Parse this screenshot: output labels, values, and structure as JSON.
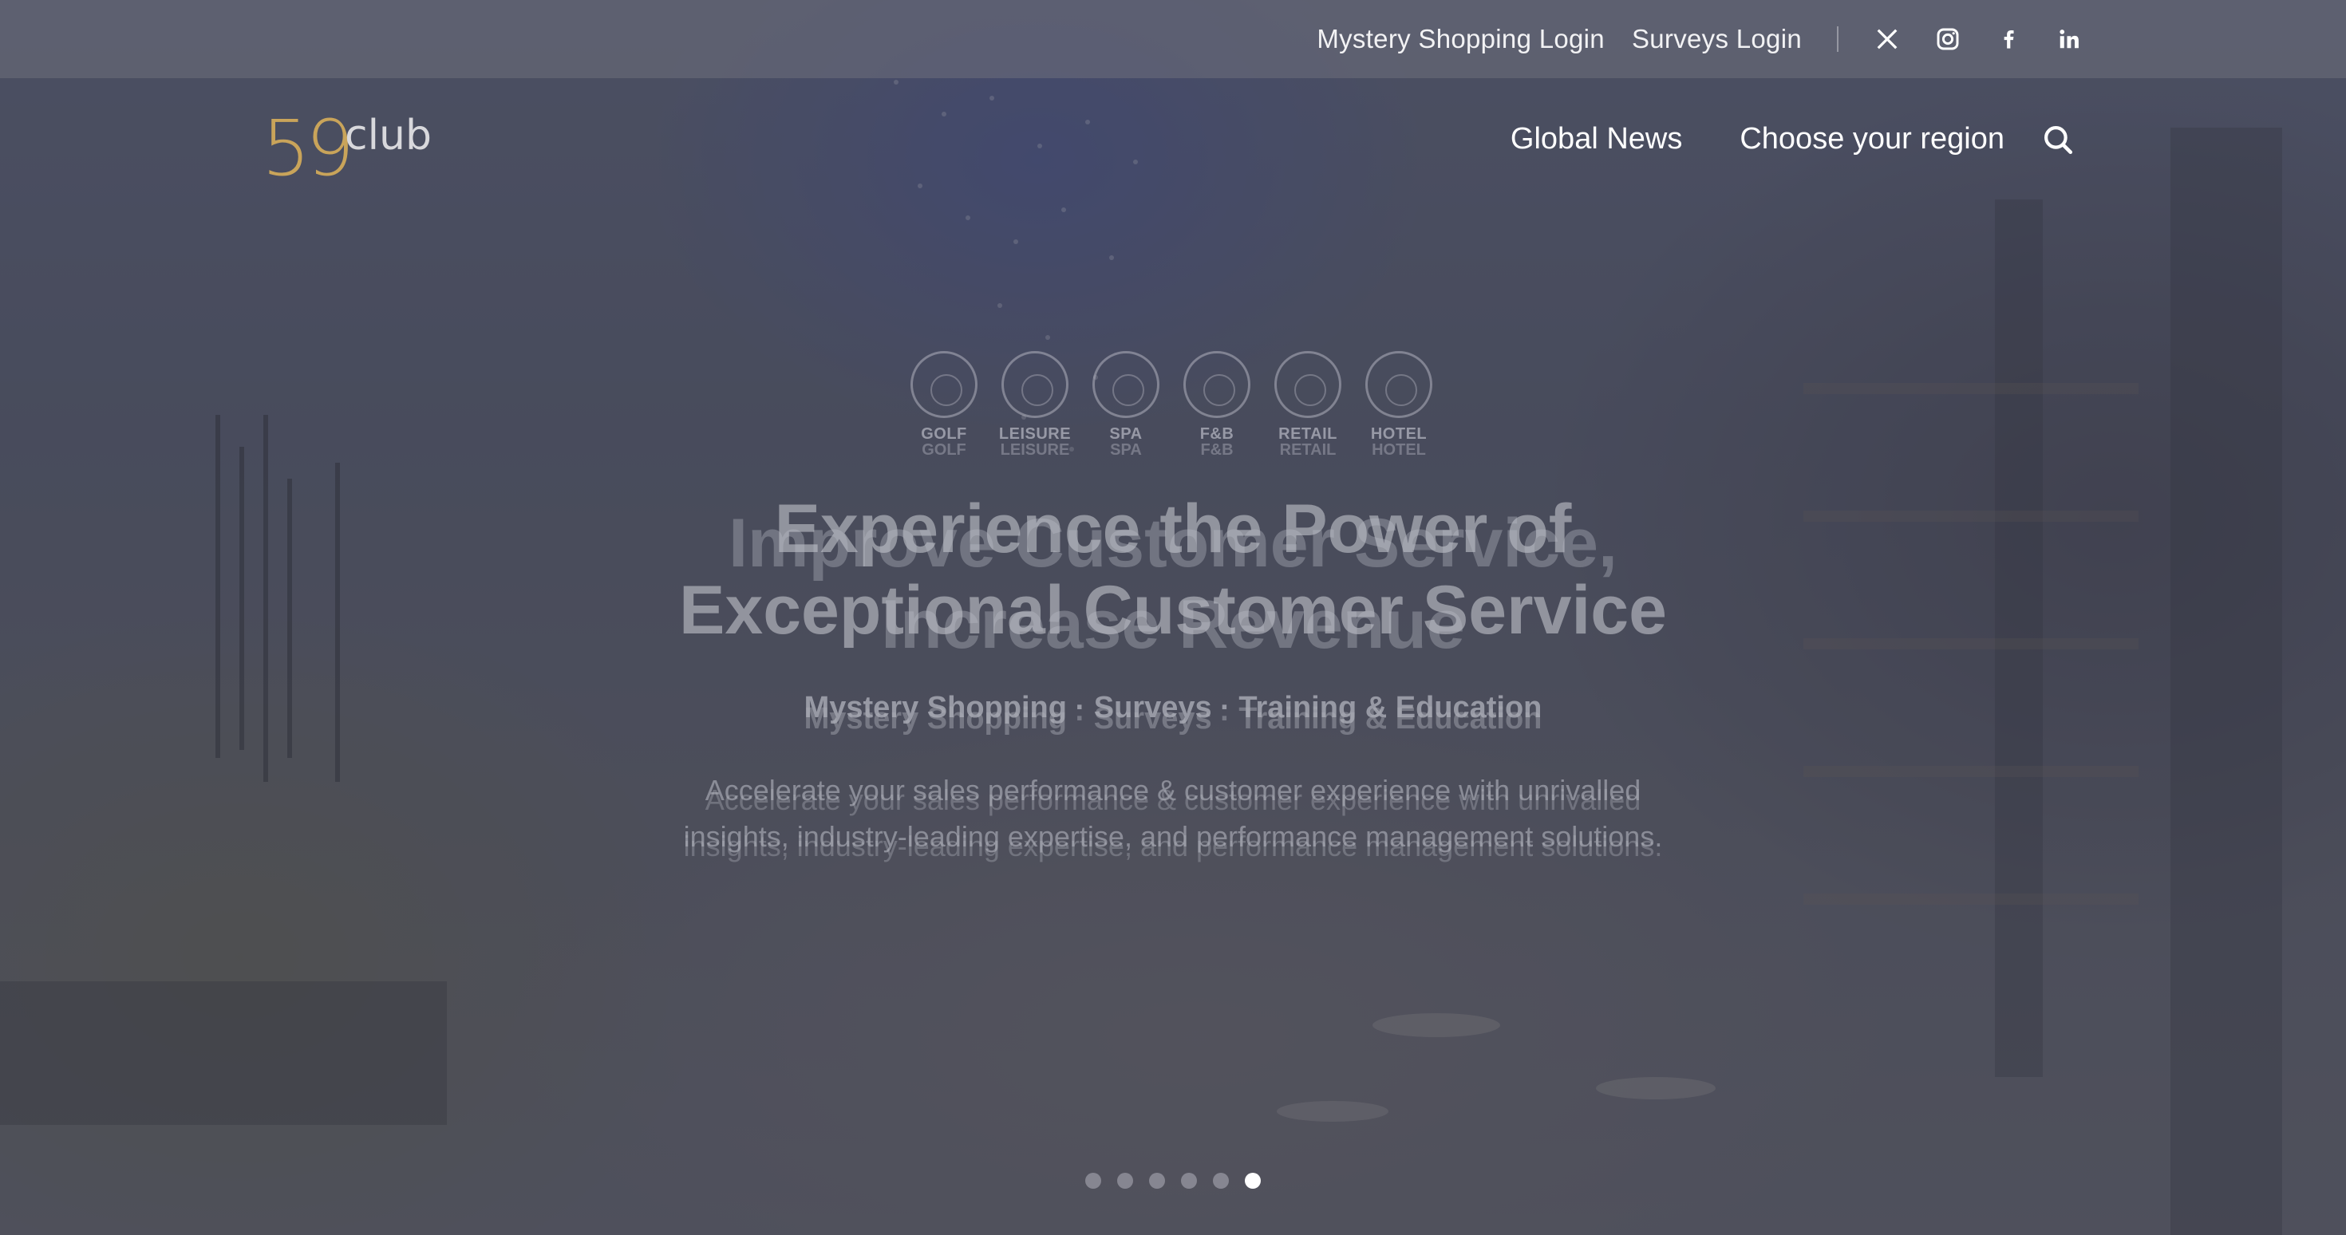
{
  "topbar": {
    "mystery_login": "Mystery Shopping Login",
    "surveys_login": "Surveys Login",
    "social": [
      "x-icon",
      "instagram-icon",
      "facebook-icon",
      "linkedin-icon"
    ]
  },
  "nav": {
    "logo_number": "59",
    "logo_word": "club",
    "global_news": "Global News",
    "choose_region": "Choose your region"
  },
  "hero": {
    "categories": [
      {
        "label": "GOLF"
      },
      {
        "label": "LEISURE"
      },
      {
        "label": "SPA"
      },
      {
        "label": "F&B"
      },
      {
        "label": "RETAIL"
      },
      {
        "label": "HOTEL"
      }
    ],
    "headline_line1": "Experience the Power of",
    "headline_line2": "Exceptional Customer Service",
    "headline_ghost_line1": "Improve Customer Service,",
    "headline_ghost_line2": "Increase Revenue",
    "services": "Mystery Shopping · Surveys · Training & Education",
    "description_line1": "Accelerate your sales performance & customer experience with unrivalled",
    "description_line2": "insights, industry-leading expertise, and performance management solutions."
  },
  "slider": {
    "count": 6,
    "active_index": 5
  },
  "colors": {
    "logo_gold": "#c9a45a",
    "text_white": "#ffffff"
  }
}
